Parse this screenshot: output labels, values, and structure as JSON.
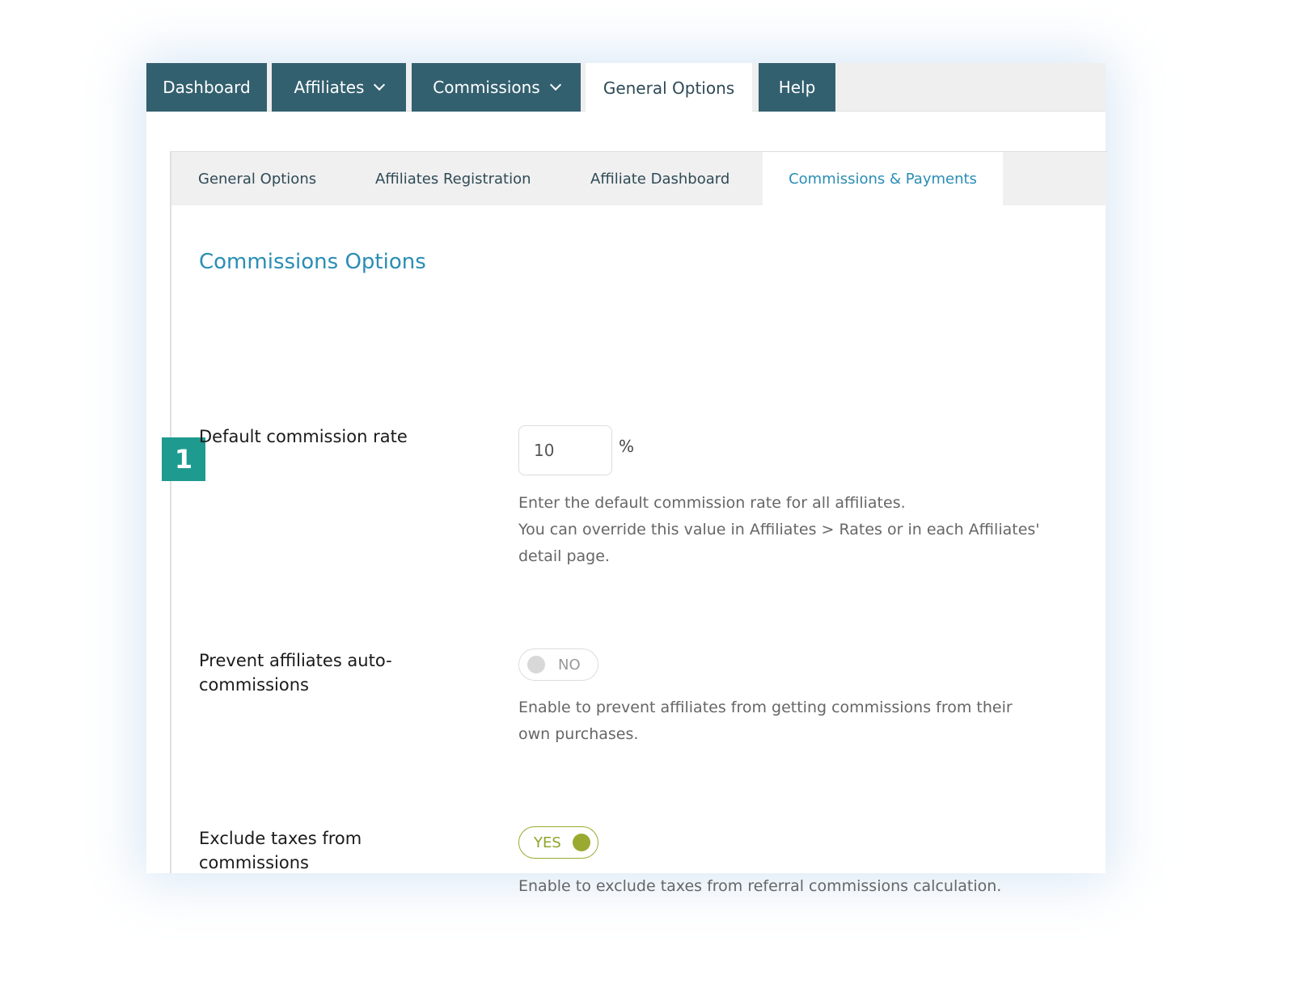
{
  "topnav": {
    "items": [
      {
        "label": "Dashboard"
      },
      {
        "label": "Affiliates"
      },
      {
        "label": "Commissions"
      },
      {
        "label": "General Options",
        "active": true
      },
      {
        "label": "Help"
      }
    ]
  },
  "subnav": {
    "items": [
      {
        "label": "General Options"
      },
      {
        "label": "Affiliates Registration"
      },
      {
        "label": "Affiliate Dashboard"
      },
      {
        "label": "Commissions & Payments",
        "active": true
      }
    ]
  },
  "section": {
    "title": "Commissions Options",
    "step_badge": "1"
  },
  "settings": {
    "rate": {
      "label": "Default commission rate",
      "value": "10",
      "unit": "%",
      "desc1": "Enter the default commission rate for all affiliates.",
      "desc2": "You can override this value in Affiliates > Rates or in each Affiliates' detail page."
    },
    "prevent": {
      "label": "Prevent affiliates auto-commissions",
      "toggle": "NO",
      "enabled": false,
      "desc": "Enable to prevent affiliates from getting commissions from their own purchases."
    },
    "taxes": {
      "label": "Exclude taxes from commissions",
      "toggle": "YES",
      "enabled": true,
      "desc": "Enable to exclude taxes from referral commissions calculation."
    }
  },
  "colors": {
    "nav": "#33606f",
    "accent": "#2a8db5",
    "badge": "#1e9a8e",
    "toggle_on": "#9aaa30"
  }
}
